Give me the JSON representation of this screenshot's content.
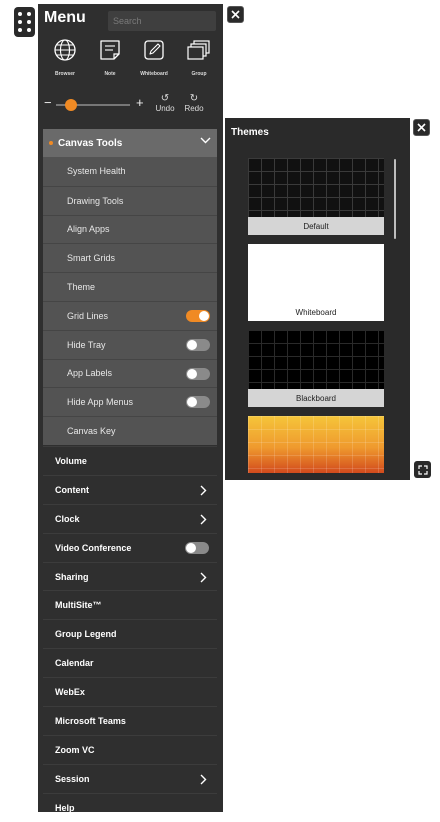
{
  "menu": {
    "title": "Menu",
    "search_placeholder": "Search",
    "apps": [
      {
        "label": "Browser",
        "icon": "globe-icon"
      },
      {
        "label": "Note",
        "icon": "note-icon"
      },
      {
        "label": "Whiteboard",
        "icon": "whiteboard-icon"
      },
      {
        "label": "Group",
        "icon": "group-icon"
      }
    ],
    "zoom": {
      "minus": "−",
      "plus": "+",
      "level": 0.2
    },
    "undo_label": "Undo",
    "redo_label": "Redo"
  },
  "canvas_tools": {
    "label": "Canvas Tools",
    "items": [
      {
        "label": "System Health"
      },
      {
        "label": "Drawing Tools"
      },
      {
        "label": "Align Apps"
      },
      {
        "label": "Smart Grids"
      },
      {
        "label": "Theme"
      },
      {
        "label": "Grid Lines",
        "toggle": "on"
      },
      {
        "label": "Hide Tray",
        "toggle": "off"
      },
      {
        "label": "App Labels",
        "toggle": "off"
      },
      {
        "label": "Hide App Menus",
        "toggle": "off"
      },
      {
        "label": "Canvas Key"
      }
    ]
  },
  "main_items": [
    {
      "label": "Volume"
    },
    {
      "label": "Content",
      "chevron": true
    },
    {
      "label": "Clock",
      "chevron": true
    },
    {
      "label": "Video Conference",
      "toggle": "off"
    },
    {
      "label": "Sharing",
      "chevron": true
    },
    {
      "label": "MultiSite™"
    },
    {
      "label": "Group Legend"
    },
    {
      "label": "Calendar"
    },
    {
      "label": "WebEx"
    },
    {
      "label": "Microsoft Teams"
    },
    {
      "label": "Zoom VC"
    },
    {
      "label": "Session",
      "chevron": true
    },
    {
      "label": "Help"
    }
  ],
  "themes_panel": {
    "title": "Themes",
    "themes": [
      {
        "label": "Default"
      },
      {
        "label": "Whiteboard"
      },
      {
        "label": "Blackboard"
      },
      {
        "label": ""
      }
    ]
  },
  "colors": {
    "accent": "#f08a24",
    "panel": "#2f2f2f",
    "subpanel": "#535353"
  }
}
